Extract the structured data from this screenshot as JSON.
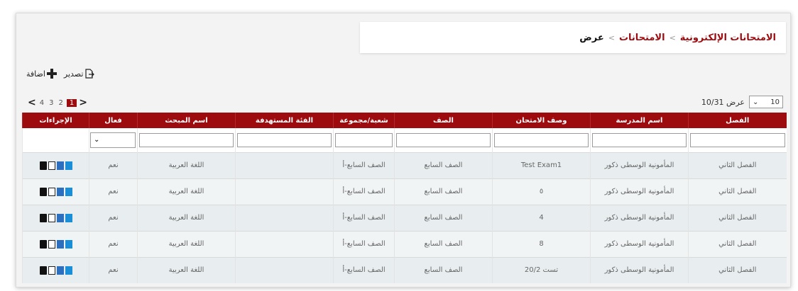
{
  "breadcrumb": {
    "items": [
      "الامتحانات الإلكترونية",
      "الامتحانات"
    ],
    "separator": ">",
    "current": "عرض"
  },
  "actions": {
    "add_label": "اضافة",
    "export_label": "تصدير"
  },
  "pagination": {
    "prev": "<",
    "next": ">",
    "pages": [
      "1",
      "2",
      "3",
      "4"
    ],
    "active": "1"
  },
  "page_size": {
    "value": "10",
    "info": "عرض 10/31"
  },
  "table": {
    "headers": [
      "الفصل",
      "اسم المدرسة",
      "وصف الامتحان",
      "الصف",
      "شعبة/مجموعة",
      "الفئة المستهدفة",
      "اسم المبحث",
      "فعال",
      "الإجراءات"
    ],
    "rows": [
      [
        "الفصل الثاني",
        "المأمونية الوسطى ذكور",
        "Test Exam1",
        "الصف السابع",
        "الصف السابع-أ",
        "",
        "اللغة العربية",
        "نعم"
      ],
      [
        "الفصل الثاني",
        "المأمونية الوسطى ذكور",
        "٥",
        "الصف السابع",
        "الصف السابع-أ",
        "",
        "اللغة العربية",
        "نعم"
      ],
      [
        "الفصل الثاني",
        "المأمونية الوسطى ذكور",
        "4",
        "الصف السابع",
        "الصف السابع-أ",
        "",
        "اللغة العربية",
        "نعم"
      ],
      [
        "الفصل الثاني",
        "المأمونية الوسطى ذكور",
        "8",
        "الصف السابع",
        "الصف السابع-أ",
        "",
        "اللغة العربية",
        "نعم"
      ],
      [
        "الفصل الثاني",
        "المأمونية الوسطى ذكور",
        "تست 20/2",
        "الصف السابع",
        "الصف السابع-أ",
        "",
        "اللغة العربية",
        "نعم"
      ]
    ]
  },
  "colors": {
    "accent": "#9e0b0f",
    "row_odd": "#e8eef0",
    "row_even": "#f1f4f5"
  },
  "icons": [
    "plus-icon",
    "export-icon",
    "trash-icon",
    "edit-icon",
    "view-icon",
    "doc-icon",
    "chevron-down-icon"
  ]
}
